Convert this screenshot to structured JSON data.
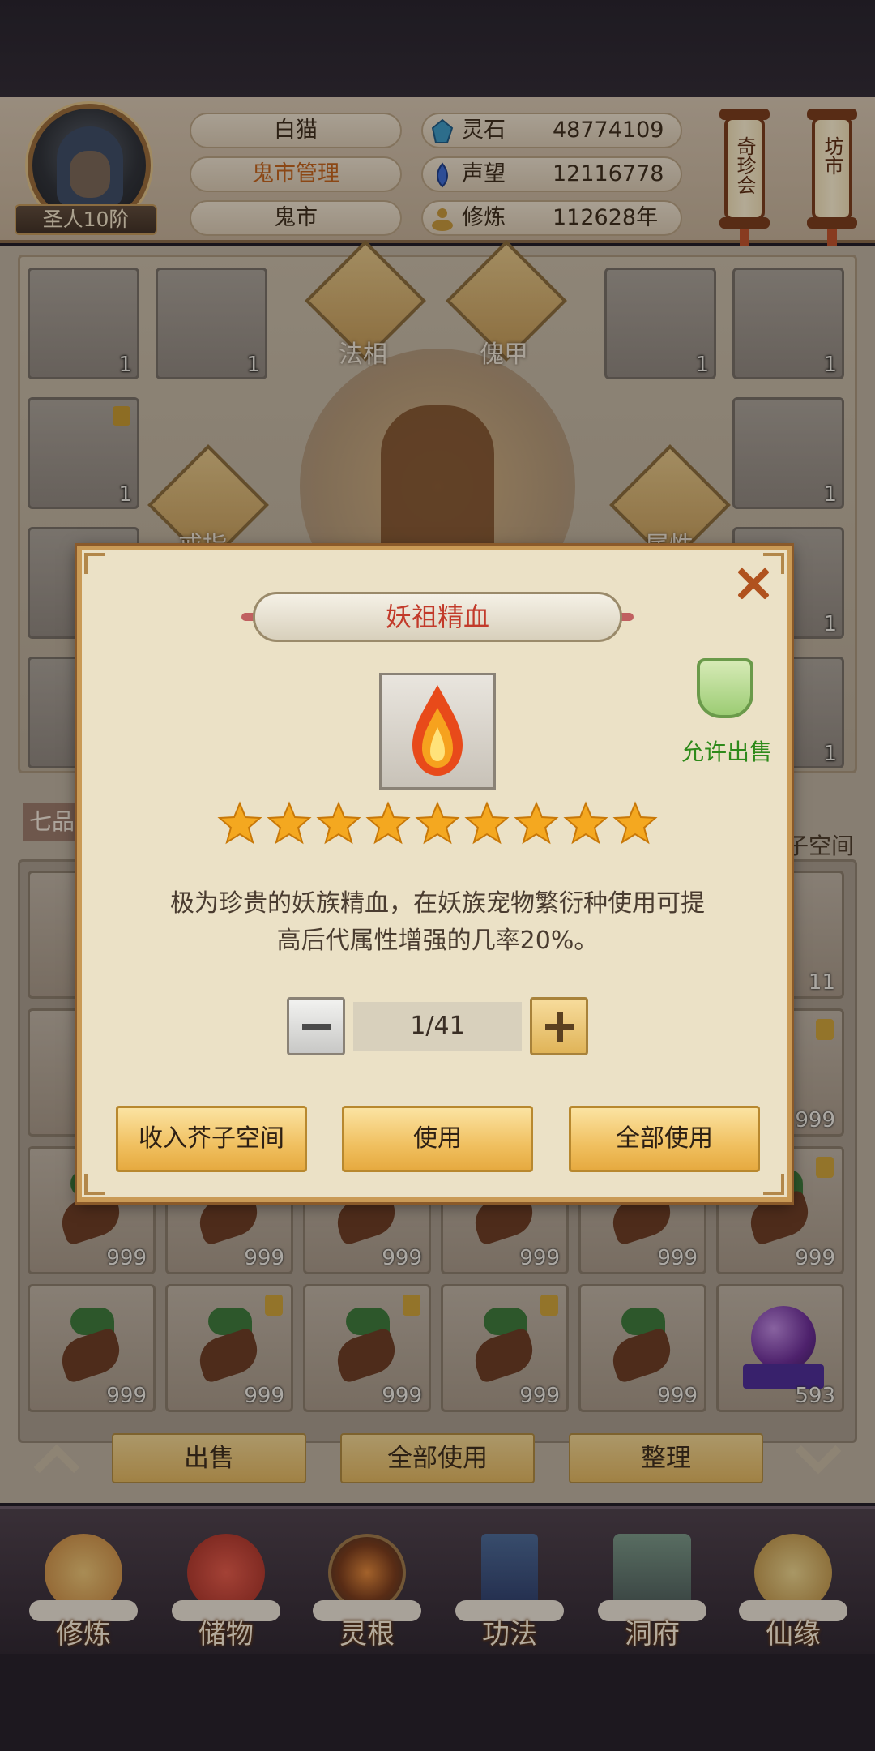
{
  "player": {
    "rank": "圣人10阶",
    "name": "白猫",
    "role": "鬼市管理",
    "location": "鬼市"
  },
  "resources": [
    {
      "label": "灵石",
      "value": "48774109",
      "icon": "spirit-stone-icon",
      "color": "#3a9ac8"
    },
    {
      "label": "声望",
      "value": "12116778",
      "icon": "reputation-icon",
      "color": "#3a6ad8"
    },
    {
      "label": "修炼",
      "value": "112628年",
      "icon": "cultivation-icon",
      "color": "#c8983a"
    }
  ],
  "side_tabs": {
    "treasure_auction": "奇珍会",
    "market": "坊市"
  },
  "equipment": {
    "labels": [
      "法相",
      "傀甲",
      "戒指",
      "属性"
    ],
    "slot_qty": "1",
    "right_partial_label": "子空间"
  },
  "bag": {
    "tab_partial": "七品",
    "quantities": [
      "11",
      "999",
      "999",
      "999",
      "999",
      "999",
      "999",
      "999",
      "999",
      "999",
      "999",
      "999",
      "999",
      "593"
    ]
  },
  "bag_actions": {
    "sell": "出售",
    "use_all": "全部使用",
    "sort": "整理"
  },
  "nav": [
    {
      "label": "修炼",
      "icon": "cultivate-icon"
    },
    {
      "label": "储物",
      "icon": "storage-bag-icon"
    },
    {
      "label": "灵根",
      "icon": "spirit-root-icon"
    },
    {
      "label": "功法",
      "icon": "technique-book-icon"
    },
    {
      "label": "洞府",
      "icon": "cave-dwelling-icon"
    },
    {
      "label": "仙缘",
      "icon": "immortal-fate-icon"
    }
  ],
  "modal": {
    "title": "妖祖精血",
    "item_icon": "blood-drop-flame-icon",
    "sellable_label": "允许出售",
    "star_count": 9,
    "description_line1": "极为珍贵的妖族精血，在妖族宠物繁衍种使用可提",
    "description_line2": "高后代属性增强的几率20%。",
    "quantity": "1/41",
    "btn_store": "收入芥子空间",
    "btn_use": "使用",
    "btn_use_all": "全部使用"
  },
  "colors": {
    "title_red": "#c23a2a",
    "sellable_green": "#2e8a1a",
    "star_gold": "#f4a820",
    "button_gold": "#f0c060"
  }
}
